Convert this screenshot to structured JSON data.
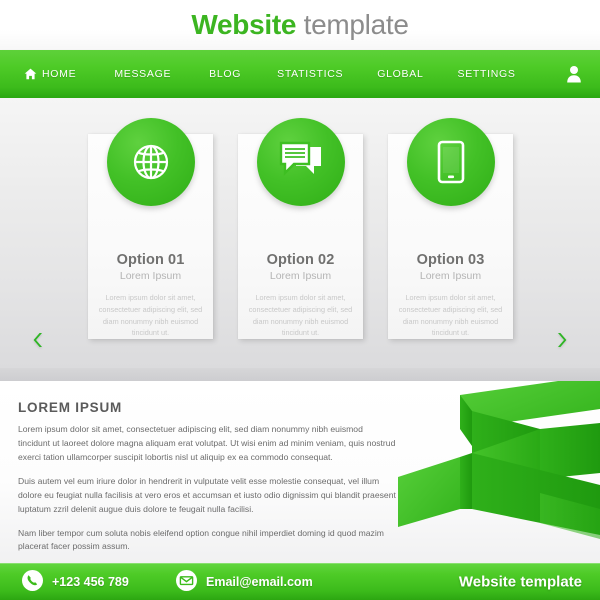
{
  "header": {
    "logo_green": "Website",
    "logo_gray": "template"
  },
  "nav": {
    "home_icon": "home-icon",
    "user_icon": "user-account-icon",
    "items": [
      {
        "label": "HOME"
      },
      {
        "label": "MESSAGE"
      },
      {
        "label": "BLOG"
      },
      {
        "label": "STATISTICS"
      },
      {
        "label": "GLOBAL"
      },
      {
        "label": "SETTINGS"
      }
    ]
  },
  "slider": {
    "prev_icon": "chevron-left-icon",
    "next_icon": "chevron-right-icon",
    "cards": [
      {
        "icon": "globe-icon",
        "title": "Option 01",
        "subtitle": "Lorem Ipsum",
        "body": "Lorem ipsum dolor sit amet, consectetuer adipiscing elit, sed diam nonummy nibh euismod tincidunt ut."
      },
      {
        "icon": "chat-bubbles-icon",
        "title": "Option 02",
        "subtitle": "Lorem Ipsum",
        "body": "Lorem ipsum dolor sit amet, consectetuer adipiscing elit, sed diam nonummy nibh euismod tincidunt ut."
      },
      {
        "icon": "smartphone-icon",
        "title": "Option 03",
        "subtitle": "Lorem Ipsum",
        "body": "Lorem ipsum dolor sit amet, consectetuer adipiscing elit, sed diam nonummy nibh euismod tincidunt ut."
      }
    ]
  },
  "content": {
    "heading": "LOREM IPSUM",
    "paragraph_1": "Lorem ipsum dolor sit amet, consectetuer adipiscing elit, sed diam nonummy nibh euismod tincidunt ut laoreet dolore magna aliquam erat volutpat. Ut wisi enim ad minim veniam, quis nostrud exerci tation ullamcorper suscipit lobortis nisl ut aliquip ex ea commodo consequat.",
    "paragraph_2": "Duis autem vel eum iriure dolor in hendrerit in vulputate velit esse molestie consequat, vel illum dolore eu feugiat nulla facilisis at vero eros et accumsan et iusto odio dignissim qui blandit praesent luptatum zzril delenit augue duis dolore te feugait nulla facilisi.",
    "paragraph_3": "Nam liber tempor cum soluta nobis eleifend option congue nihil imperdiet doming id quod mazim placerat facer possim assum.",
    "ribbon_graphic": "folded-ribbon-graphic"
  },
  "footer": {
    "phone_icon": "phone-icon",
    "phone": "+123 456 789",
    "mail_icon": "envelope-icon",
    "email": "Email@email.com",
    "brand": "Website template"
  },
  "colors": {
    "brand_green": "#3cb521",
    "nav_green_light": "#5ed13a",
    "nav_green_dark": "#2aa811",
    "title_gray": "#8c8c8c",
    "body_gray": "#6c6c6c",
    "card_text_gray": "#c8c8c8"
  }
}
